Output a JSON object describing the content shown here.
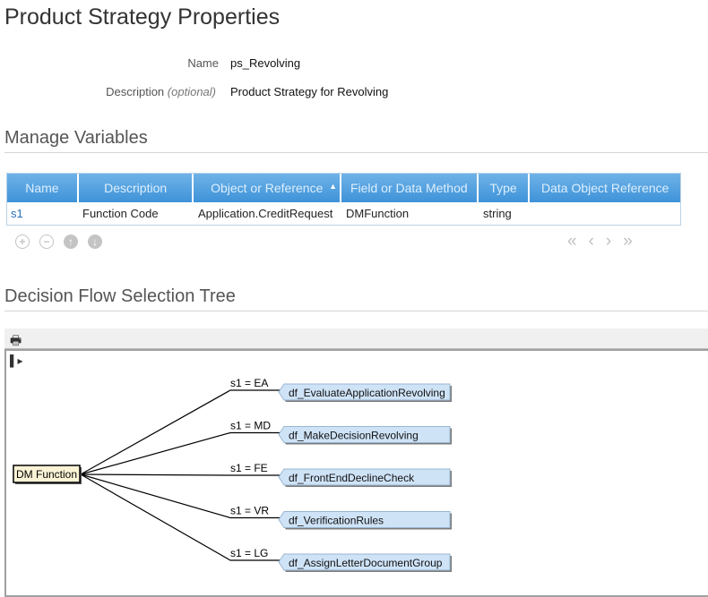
{
  "page": {
    "title": "Product Strategy Properties"
  },
  "properties": {
    "name_label": "Name",
    "name_value": "ps_Revolving",
    "description_label": "Description",
    "description_optional": "(optional)",
    "description_value": "Product Strategy for Revolving"
  },
  "variables": {
    "section_title": "Manage Variables",
    "columns": [
      "Name",
      "Description",
      "Object or Reference",
      "Field or Data Method",
      "Type",
      "Data Object Reference"
    ],
    "sorted_column": "Object or Reference",
    "rows": [
      {
        "name": "s1",
        "description": "Function Code",
        "object": "Application.CreditRequest",
        "field": "DMFunction",
        "type": "string",
        "data_object_reference": ""
      }
    ],
    "actions": [
      "add-icon",
      "remove-icon",
      "move-up-icon",
      "move-down-icon"
    ],
    "pager": [
      "first-page-icon",
      "previous-page-icon",
      "next-page-icon",
      "last-page-icon"
    ]
  },
  "tree": {
    "section_title": "Decision Flow Selection Tree",
    "root_label": "DM Function",
    "branches": [
      {
        "condition": "s1 = EA",
        "flow": "df_EvaluateApplicationRevolving"
      },
      {
        "condition": "s1 = MD",
        "flow": "df_MakeDecisionRevolving"
      },
      {
        "condition": "s1 = FE",
        "flow": "df_FrontEndDeclineCheck"
      },
      {
        "condition": "s1 = VR",
        "flow": "df_VerificationRules"
      },
      {
        "condition": "s1 = LG",
        "flow": "df_AssignLetterDocumentGroup"
      }
    ]
  },
  "colors": {
    "header_blue": "#4a9de0",
    "node_fill": "#cfe3f7",
    "link": "#2a6fb5"
  }
}
